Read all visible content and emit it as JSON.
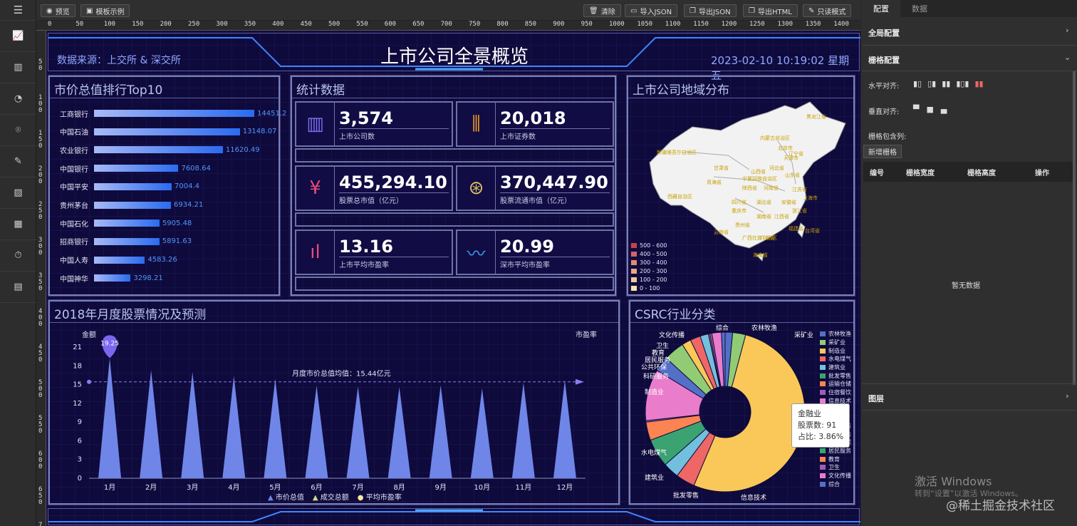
{
  "toolbar": {
    "preview": "预览",
    "template": "模板示例",
    "clear": "清除",
    "import_json": "导入JSON",
    "export_json": "导出JSON",
    "export_html": "导出HTML",
    "readonly": "只读模式"
  },
  "left_icons": [
    "menu-icon",
    "line-chart-icon",
    "bar-chart-icon",
    "pie-chart-icon",
    "map-icon",
    "edit-icon",
    "image-icon",
    "grid-icon",
    "timer-icon",
    "table-icon"
  ],
  "ruler_h": [
    "0",
    "50",
    "100",
    "150",
    "200",
    "250",
    "300",
    "350",
    "400",
    "450",
    "500",
    "550",
    "600",
    "650",
    "700",
    "750",
    "800",
    "850",
    "900",
    "950",
    "1000",
    "1050",
    "1100",
    "1150",
    "1200",
    "1250",
    "1300",
    "1350",
    "1400"
  ],
  "ruler_v": [
    "5\n0",
    "1\n0\n0",
    "1\n5\n0",
    "2\n0\n0",
    "2\n5\n0",
    "3\n0\n0",
    "3\n5\n0",
    "4\n0\n0",
    "4\n5\n0",
    "5\n0\n0",
    "5\n5\n0",
    "6\n0\n0",
    "6\n5\n0",
    "7\n0\n0"
  ],
  "header": {
    "source": "数据来源：上交所 & 深交所",
    "title": "上市公司全景概览",
    "datetime": "2023-02-10 10:19:02 星期五"
  },
  "top10": {
    "title": "市价总值排行Top10",
    "items": [
      {
        "name": "工商银行",
        "value": 14451.2
      },
      {
        "name": "中国石油",
        "value": 13148.07
      },
      {
        "name": "农业银行",
        "value": 11620.49
      },
      {
        "name": "中国银行",
        "value": 7608.64
      },
      {
        "name": "中国平安",
        "value": 7004.4
      },
      {
        "name": "贵州茅台",
        "value": 6934.21
      },
      {
        "name": "中国石化",
        "value": 5905.48
      },
      {
        "name": "招商银行",
        "value": 5891.63
      },
      {
        "name": "中国人寿",
        "value": 4583.26
      },
      {
        "name": "中国神华",
        "value": 3298.21
      }
    ]
  },
  "stats": {
    "title": "统计数据",
    "items": [
      {
        "value": "3,574",
        "label": "上市公司数",
        "icon": "building-icon",
        "color": "#7b6ff0"
      },
      {
        "value": "20,018",
        "label": "上市证券数",
        "icon": "candlestick-icon",
        "color": "#f0a020"
      },
      {
        "value": "455,294.10",
        "label": "股票总市值（亿元）",
        "icon": "yuan-icon",
        "color": "#e84a7a"
      },
      {
        "value": "370,447.90",
        "label": "股票流通市值（亿元）",
        "icon": "yuan-coin-icon",
        "color": "#d8c060"
      },
      {
        "value": "13.16",
        "label": "上市平均市盈率",
        "icon": "bar-icon",
        "color": "#e84a7a"
      },
      {
        "value": "20.99",
        "label": "深市平均市盈率",
        "icon": "pulse-icon",
        "color": "#3aa0f0"
      }
    ]
  },
  "map": {
    "title": "上市公司地域分布",
    "legend": [
      "500 - 600",
      "400 - 500",
      "300 - 400",
      "200 - 300",
      "100 - 200",
      "0 - 100"
    ],
    "legend_colors": [
      "#c8404a",
      "#d8606a",
      "#e08a76",
      "#e8a884",
      "#f0c898",
      "#f8e4a8"
    ],
    "labels": [
      "黑龙江省",
      "内蒙古自治区",
      "辽宁省",
      "新疆维吾尔自治区",
      "北京市",
      "天津市",
      "甘肃省",
      "河北省",
      "山西省",
      "山东省",
      "青海省",
      "宁夏回族自治区",
      "陕西省",
      "河南省",
      "江苏省",
      "上海市",
      "西藏自治区",
      "四川省",
      "湖北省",
      "安徽省",
      "浙江省",
      "重庆市",
      "湖南省",
      "江西省",
      "福建省",
      "贵州省",
      "云南省",
      "广西壮族自治区",
      "广东省",
      "台湾省",
      "海南省"
    ]
  },
  "monthly": {
    "title": "2018年月度股票情况及预测",
    "ylabel": "金额",
    "y2label": "市盈率",
    "markline": "月度市价总值均值：15.44亿元",
    "pin": "19.25",
    "legend": [
      "市价总值",
      "成交总额",
      "平均市盈率"
    ]
  },
  "chart_data": [
    {
      "type": "bar",
      "title": "市价总值排行Top10",
      "categories": [
        "工商银行",
        "中国石油",
        "农业银行",
        "中国银行",
        "中国平安",
        "贵州茅台",
        "中国石化",
        "招商银行",
        "中国人寿",
        "中国神华"
      ],
      "values": [
        14451.2,
        13148.07,
        11620.49,
        7608.64,
        7004.4,
        6934.21,
        5905.48,
        5891.63,
        4583.26,
        3298.21
      ]
    },
    {
      "type": "bar",
      "title": "2018年月度股票情况及预测",
      "categories": [
        "1月",
        "2月",
        "3月",
        "4月",
        "5月",
        "6月",
        "7月",
        "8月",
        "9月",
        "10月",
        "11月",
        "12月"
      ],
      "ylabel": "金额",
      "ylim": [
        0,
        21
      ],
      "yticks": [
        0,
        3,
        6,
        9,
        12,
        15,
        18,
        21
      ],
      "series": [
        {
          "name": "市价总值",
          "values": [
            19.25,
            17.3,
            17.0,
            16.4,
            15.9,
            14.8,
            14.7,
            14.6,
            14.9,
            14.4,
            15.3,
            15.7
          ]
        }
      ],
      "markline": {
        "label": "月度市价总值均值：15.44亿元",
        "value": 15.44
      }
    },
    {
      "type": "pie",
      "title": "CSRC行业分类",
      "categories": [
        "农林牧渔",
        "采矿业",
        "制造业",
        "水电煤气",
        "建筑业",
        "批发零售",
        "运输仓储",
        "住宿餐饮",
        "信息技术",
        "金融业",
        "房地产",
        "商务服务",
        "科研服务",
        "公共环保",
        "居民服务",
        "教育",
        "卫生",
        "文化传播",
        "综合"
      ],
      "values": [
        45,
        78,
        1550,
        115,
        96,
        170,
        110,
        9,
        310,
        91,
        125,
        55,
        62,
        50,
        1,
        8,
        12,
        57,
        22
      ],
      "colors": [
        "#5470c6",
        "#91cc75",
        "#fac858",
        "#ee6666",
        "#73c0de",
        "#3ba272",
        "#fc8452",
        "#9a60b4",
        "#ea7ccc",
        "#5470c6",
        "#91cc75",
        "#fac858",
        "#ee6666",
        "#73c0de",
        "#3ba272",
        "#fc8452",
        "#9a60b4",
        "#ea7ccc",
        "#5470c6"
      ]
    }
  ],
  "csrc": {
    "title": "CSRC行业分类",
    "legend": [
      "农林牧渔",
      "采矿业",
      "制造业",
      "水电煤气",
      "建筑业",
      "批发零售",
      "运输仓储",
      "住宿餐饮",
      "信息技术",
      "金融业",
      "房地产",
      "商务服务",
      "科研服务",
      "公共环保",
      "居民服务",
      "教育",
      "卫生",
      "文化传播",
      "综合"
    ],
    "outer_labels": [
      "综合",
      "农林牧渔",
      "采矿业",
      "文化传播",
      "卫生",
      "教育",
      "居民服务",
      "公共环保",
      "科研服务",
      "制造业",
      "水电煤气",
      "建筑业",
      "批发零售",
      "信息技术"
    ],
    "tooltip": {
      "name": "金融业",
      "count_label": "股票数:",
      "count": "91",
      "ratio_label": "占比:",
      "ratio": "3.86%"
    }
  },
  "right": {
    "tabs": [
      "配置",
      "数据"
    ],
    "global": "全局配置",
    "grid": "栅格配置",
    "halign": "水平对齐:",
    "valign": "垂直对齐:",
    "cols": "栅格包含列:",
    "add": "新增栅格",
    "table_headers": [
      "编号",
      "栅格宽度",
      "栅格高度",
      "操作"
    ],
    "empty": "暂无数据",
    "layers": "图层"
  },
  "watermark": {
    "line1": "激活 Windows",
    "line2": "转到“设置”以激活 Windows。",
    "site": "@稀土掘金技术社区"
  }
}
